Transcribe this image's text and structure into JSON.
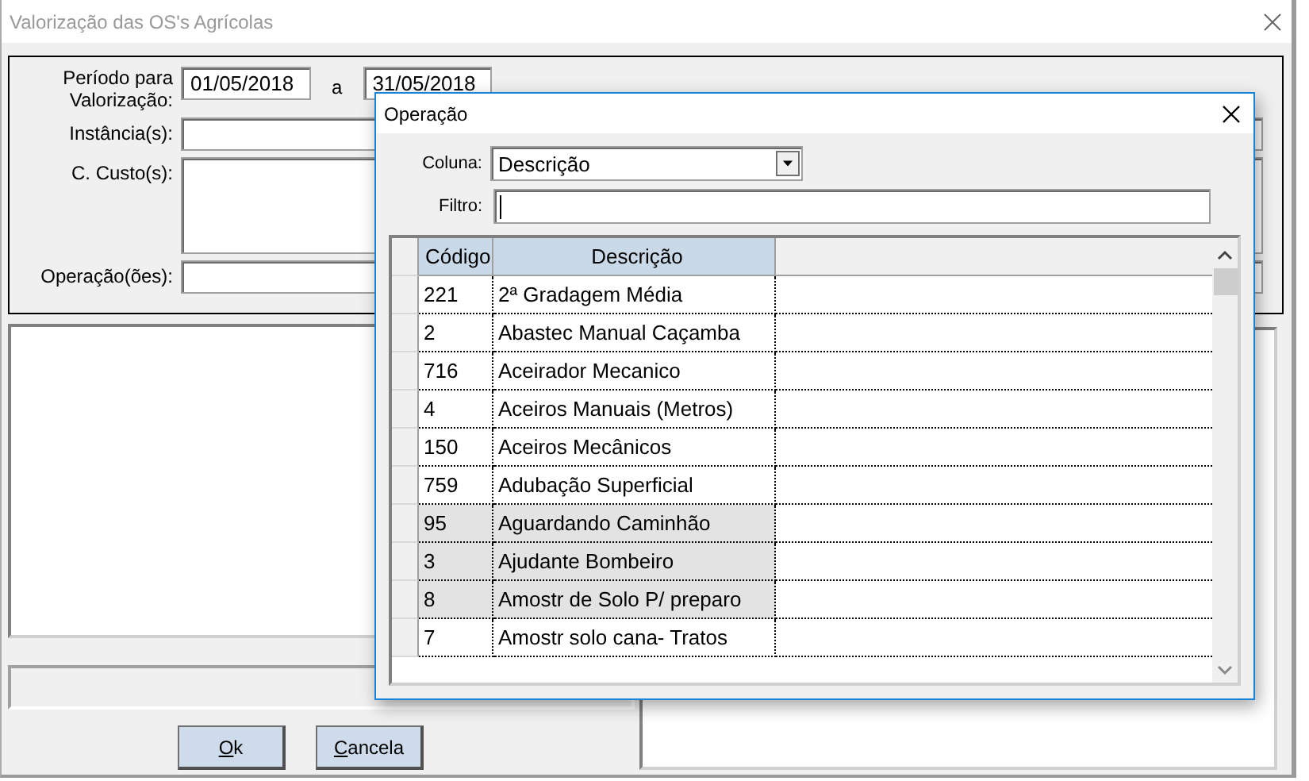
{
  "window": {
    "title": "Valorização das OS's Agrícolas",
    "active": false
  },
  "form": {
    "period_label": "Período para Valorização:",
    "date_from": "01/05/2018",
    "range_separator": "a",
    "date_to": "31/05/2018",
    "instances_label": "Instância(s):",
    "cost_centers_label": "C. Custo(s):",
    "operations_label": "Operação(ões):"
  },
  "buttons": [
    {
      "label": "Ok"
    },
    {
      "label": "Cancela"
    }
  ],
  "dialog": {
    "title": "Operação",
    "column_label": "Coluna:",
    "column_value": "Descrição",
    "filter_label": "Filtro:",
    "grid": {
      "columns": [
        "Código",
        "Descrição"
      ],
      "rows": [
        {
          "code": "221",
          "description": "2ª Gradagem Média",
          "shaded": false
        },
        {
          "code": "2",
          "description": "Abastec Manual Caçamba",
          "shaded": false
        },
        {
          "code": "716",
          "description": "Aceirador Mecanico",
          "shaded": false
        },
        {
          "code": "4",
          "description": "Aceiros Manuais (Metros)",
          "shaded": false
        },
        {
          "code": "150",
          "description": "Aceiros Mecânicos",
          "shaded": false
        },
        {
          "code": "759",
          "description": "Adubação Superficial",
          "shaded": false
        },
        {
          "code": "95",
          "description": "Aguardando Caminhão",
          "shaded": true
        },
        {
          "code": "3",
          "description": "Ajudante Bombeiro",
          "shaded": true
        },
        {
          "code": "8",
          "description": "Amostr de Solo P/ preparo",
          "shaded": true
        },
        {
          "code": "7",
          "description": "Amostr solo cana- Tratos",
          "shaded": false
        }
      ]
    }
  }
}
